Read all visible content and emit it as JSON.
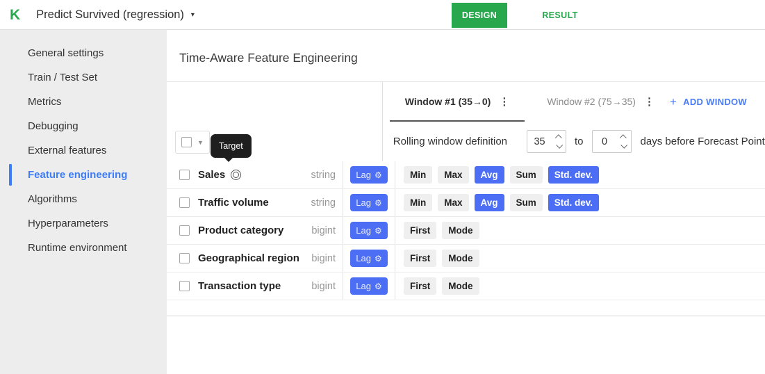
{
  "colors": {
    "brand_green": "#28a74d",
    "accent_blue": "#4c6ef5",
    "link_blue": "#3e7df6",
    "sidebar_bg": "#ededed",
    "tooltip_bg": "#1f1f1f"
  },
  "header": {
    "logo": "K",
    "project_title": "Predict Survived (regression)",
    "caret": "▾",
    "tabs": [
      {
        "label": "DESIGN",
        "active": true
      },
      {
        "label": "RESULT",
        "active": false
      }
    ]
  },
  "sidebar": {
    "items": [
      {
        "label": "General settings",
        "active": false
      },
      {
        "label": "Train / Test Set",
        "active": false
      },
      {
        "label": "Metrics",
        "active": false
      },
      {
        "label": "Debugging",
        "active": false
      },
      {
        "label": "External features",
        "active": false
      },
      {
        "label": "Feature engineering",
        "active": true
      },
      {
        "label": "Algorithms",
        "active": false
      },
      {
        "label": "Hyperparameters",
        "active": false
      },
      {
        "label": "Runtime environment",
        "active": false
      }
    ]
  },
  "main": {
    "title": "Time-Aware Feature Engineering",
    "tooltip": "Target",
    "windows": {
      "tabs": [
        {
          "label": "Window #1 (35→0)",
          "active": true
        },
        {
          "label": "Window #2 (75→35)",
          "active": false
        }
      ],
      "kebab": "⋮",
      "add_plus": "+",
      "add_label": "ADD WINDOW",
      "rolling": {
        "label": "Rolling window definition",
        "from_value": "35",
        "to_label": "to",
        "to_value": "0",
        "suffix": "days before Forecast Point"
      }
    },
    "table": {
      "lag_label": "Lag",
      "gear": "⚙",
      "features": [
        {
          "name": "Sales",
          "is_target": true,
          "type": "string",
          "aggs": [
            {
              "label": "Min",
              "selected": false
            },
            {
              "label": "Max",
              "selected": false
            },
            {
              "label": "Avg",
              "selected": true
            },
            {
              "label": "Sum",
              "selected": false
            },
            {
              "label": "Std. dev.",
              "selected": true
            }
          ]
        },
        {
          "name": "Traffic volume",
          "is_target": false,
          "type": "string",
          "aggs": [
            {
              "label": "Min",
              "selected": false
            },
            {
              "label": "Max",
              "selected": false
            },
            {
              "label": "Avg",
              "selected": true
            },
            {
              "label": "Sum",
              "selected": false
            },
            {
              "label": "Std. dev.",
              "selected": true
            }
          ]
        },
        {
          "name": "Product category",
          "is_target": false,
          "type": "bigint",
          "aggs": [
            {
              "label": "First",
              "selected": false
            },
            {
              "label": "Mode",
              "selected": false
            }
          ]
        },
        {
          "name": "Geographical region",
          "is_target": false,
          "type": "bigint",
          "aggs": [
            {
              "label": "First",
              "selected": false
            },
            {
              "label": "Mode",
              "selected": false
            }
          ]
        },
        {
          "name": "Transaction type",
          "is_target": false,
          "type": "bigint",
          "aggs": [
            {
              "label": "First",
              "selected": false
            },
            {
              "label": "Mode",
              "selected": false
            }
          ]
        }
      ]
    }
  }
}
